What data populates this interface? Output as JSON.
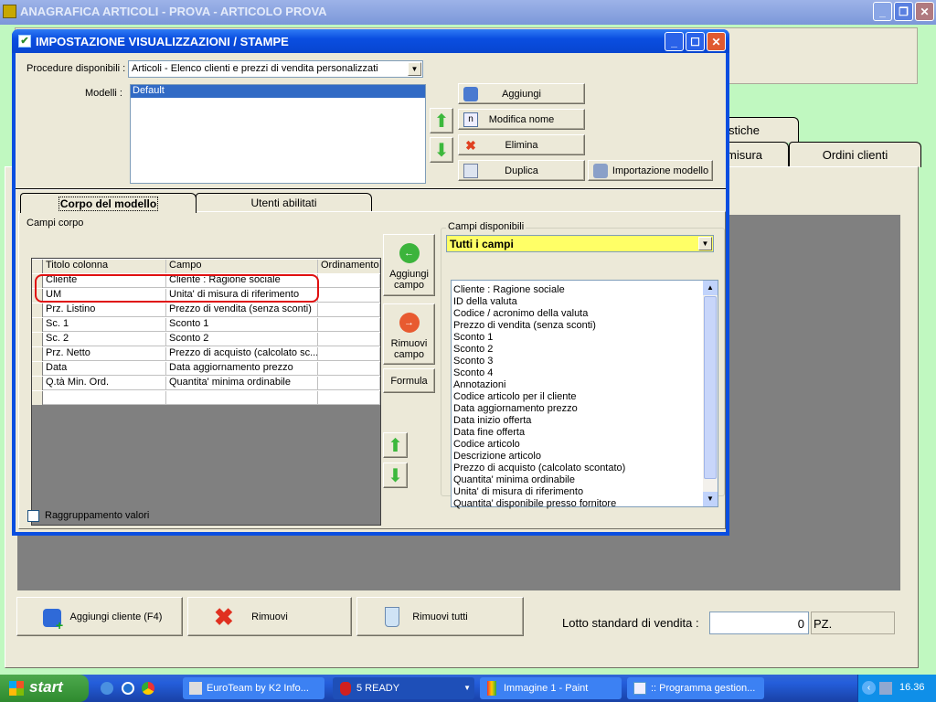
{
  "main_window": {
    "title": "ANAGRAFICA ARTICOLI - PROVA - ARTICOLO PROVA",
    "tabs_row1": [
      "stiche"
    ],
    "tabs_row2": [
      "misura",
      "Ordini clienti"
    ],
    "buttons": {
      "add_client": "Aggiungi cliente (F4)",
      "remove": "Rimuovi",
      "remove_all": "Rimuovi tutti"
    },
    "lot_label": "Lotto standard di vendita :",
    "lot_value": "0",
    "lot_unit": "PZ."
  },
  "dialog": {
    "title": "IMPOSTAZIONE VISUALIZZAZIONI / STAMPE",
    "procedures_label": "Procedure disponibili :",
    "procedure_selected": "Articoli - Elenco clienti e prezzi di vendita personalizzati",
    "models_label": "Modelli :",
    "models": [
      "Default"
    ],
    "model_buttons": {
      "add": "Aggiungi",
      "rename": "Modifica nome",
      "delete": "Elimina",
      "duplicate": "Duplica",
      "import": "Importazione modello"
    },
    "tabs": [
      "Corpo del modello",
      "Utenti abilitati"
    ],
    "active_tab": "Corpo del modello",
    "body_fields_label": "Campi corpo",
    "grid": {
      "columns": [
        "Titolo colonna",
        "Campo",
        "Ordinamento"
      ],
      "rows": [
        [
          "Cliente",
          "Cliente : Ragione sociale",
          ""
        ],
        [
          "UM",
          "Unita' di misura di riferimento",
          ""
        ],
        [
          "Prz. Listino",
          "Prezzo di vendita (senza sconti)",
          ""
        ],
        [
          "Sc. 1",
          "Sconto 1",
          ""
        ],
        [
          "Sc. 2",
          "Sconto 2",
          ""
        ],
        [
          "Prz. Netto",
          "Prezzo di acquisto (calcolato sc...",
          ""
        ],
        [
          "Data",
          "Data aggiornamento prezzo",
          ""
        ],
        [
          "Q.tà Min. Ord.",
          "Quantita' minima ordinabile",
          ""
        ],
        [
          "",
          "",
          ""
        ]
      ],
      "highlighted_row": "Prz. Listino",
      "highlight_color": "#e01010"
    },
    "field_buttons": {
      "add_field": "Aggiungi campo",
      "remove_field": "Rimuovi campo",
      "formula": "Formula"
    },
    "available_label": "Campi disponibili",
    "available_filter": "Tutti i campi",
    "available_filter_color": "#ffff66",
    "available_fields": [
      "Cliente : Ragione sociale",
      "ID della valuta",
      "Codice / acronimo della valuta",
      "Prezzo di vendita (senza sconti)",
      "Sconto 1",
      "Sconto 2",
      "Sconto 3",
      "Sconto 4",
      "Annotazioni",
      "Codice articolo per il cliente",
      "Data aggiornamento prezzo",
      "Data inizio offerta",
      "Data fine offerta",
      "Codice articolo",
      "Descrizione articolo",
      "Prezzo di acquisto (calcolato scontato)",
      "Quantita' minima ordinabile",
      "Unita' di misura di riferimento",
      "Quantita' disponibile presso fornitore"
    ],
    "grouping_label": "Raggruppamento valori",
    "grouping_checked": false
  },
  "taskbar": {
    "start": "start",
    "items": [
      "EuroTeam by K2 Info...",
      "5 READY",
      "Immagine 1 - Paint",
      ":: Programma gestion..."
    ],
    "clock": "16.36"
  }
}
